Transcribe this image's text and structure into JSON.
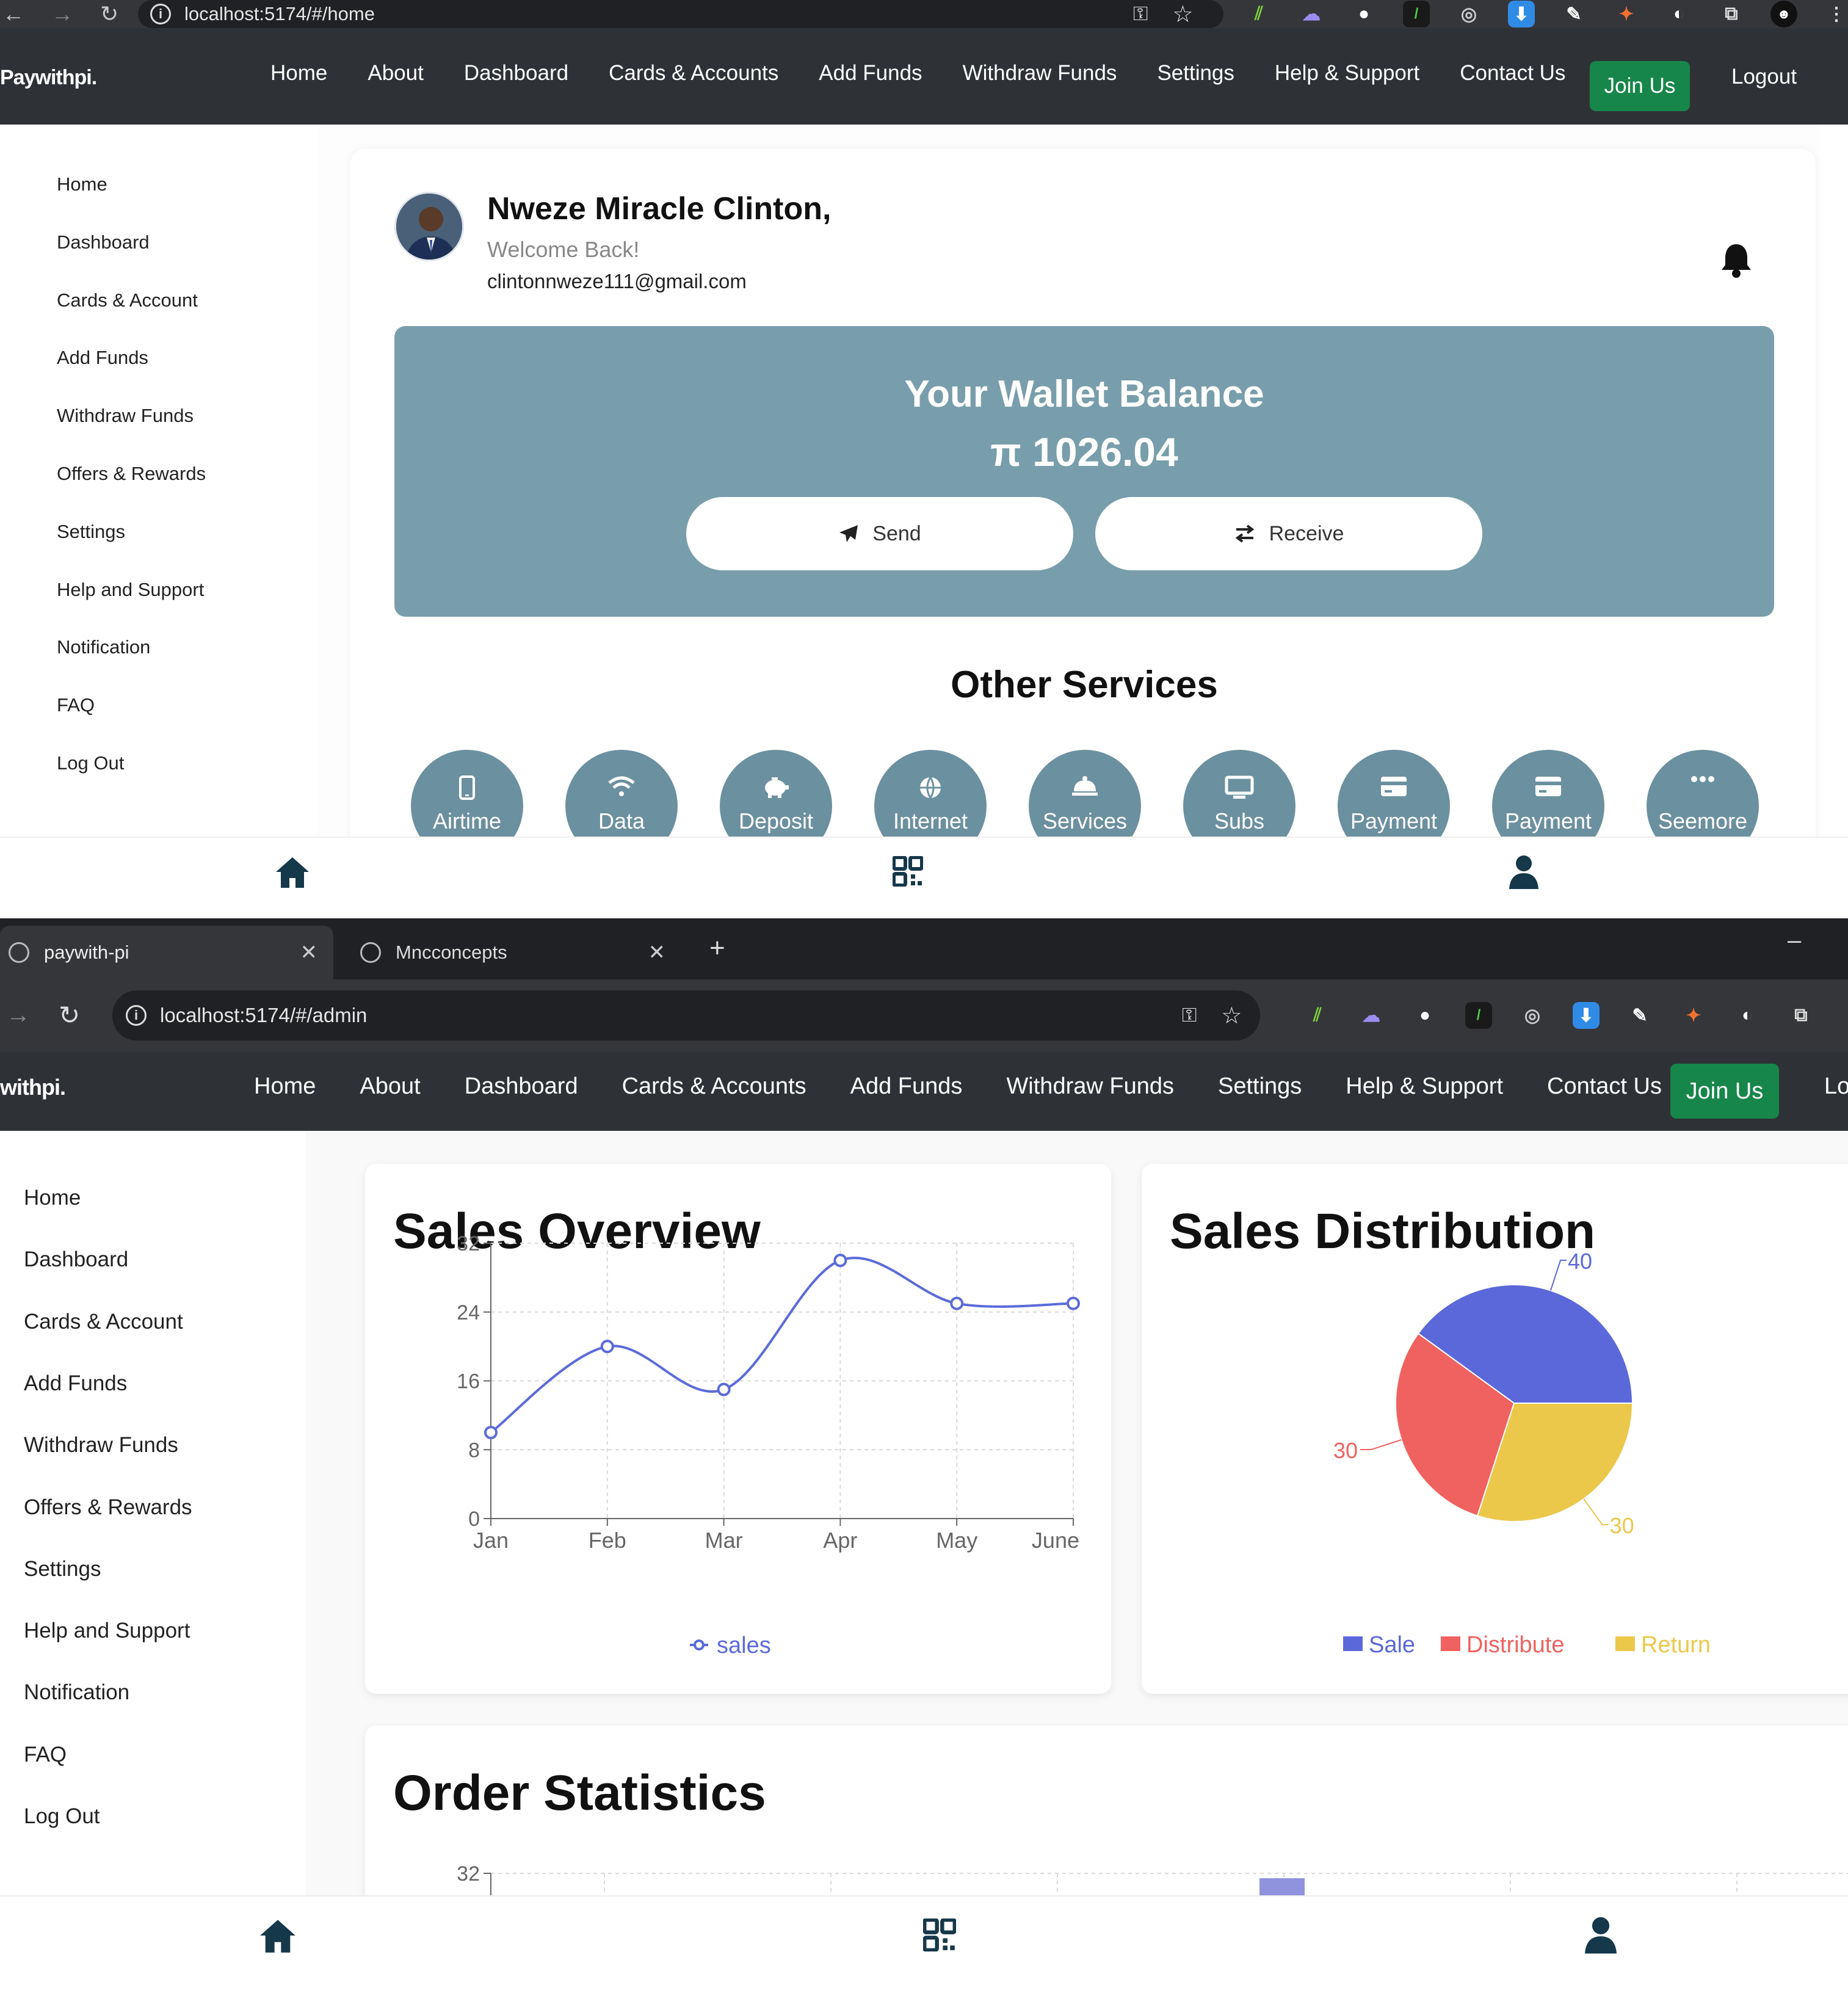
{
  "s1": {
    "url": "localhost:5174/#/home",
    "brand": "Paywithpi.",
    "nav": [
      "Home",
      "About",
      "Dashboard",
      "Cards & Accounts",
      "Add Funds",
      "Withdraw Funds",
      "Settings",
      "Help & Support",
      "Contact Us"
    ],
    "join": "Join Us",
    "logout": "Logout",
    "sidebar": [
      "Home",
      "Dashboard",
      "Cards & Account",
      "Add Funds",
      "Withdraw Funds",
      "Offers & Rewards",
      "Settings",
      "Help and Support",
      "Notification",
      "FAQ",
      "Log Out"
    ],
    "user": {
      "name": "Nweze Miracle Clinton,",
      "welcome": "Welcome Back!",
      "email": "clintonnweze111@gmail.com"
    },
    "wallet": {
      "title": "Your Wallet Balance",
      "amount": "π 1026.04",
      "send": "Send",
      "receive": "Receive"
    },
    "services_title": "Other Services",
    "services": [
      {
        "label": "Airtime",
        "icon": "phone-icon"
      },
      {
        "label": "Data",
        "icon": "wifi-icon"
      },
      {
        "label": "Deposit",
        "icon": "piggy-bank-icon"
      },
      {
        "label": "Internet",
        "icon": "globe-icon"
      },
      {
        "label": "Services",
        "icon": "bell-service-icon"
      },
      {
        "label": "Subs",
        "icon": "monitor-icon"
      },
      {
        "label": "Payment",
        "icon": "credit-card-icon"
      },
      {
        "label": "Payment",
        "icon": "credit-card-icon"
      },
      {
        "label": "Seemore",
        "icon": "more-icon"
      }
    ]
  },
  "s2": {
    "tabs": [
      "paywith-pi",
      "Mncconcepts"
    ],
    "url": "localhost:5174/#/admin",
    "brand": "withpi.",
    "nav": [
      "Home",
      "About",
      "Dashboard",
      "Cards & Accounts",
      "Add Funds",
      "Withdraw Funds",
      "Settings",
      "Help & Support",
      "Contact Us"
    ],
    "join": "Join Us",
    "logout_partial": "Lo",
    "sidebar": [
      "Home",
      "Dashboard",
      "Cards & Account",
      "Add Funds",
      "Withdraw Funds",
      "Offers & Rewards",
      "Settings",
      "Help and Support",
      "Notification",
      "FAQ",
      "Log Out"
    ],
    "panels": {
      "sales_overview": "Sales Overview",
      "sales_distribution": "Sales Distribution",
      "order_statistics": "Order Statistics"
    }
  },
  "chart_data": [
    {
      "type": "line",
      "title": "Sales Overview",
      "categories": [
        "Jan",
        "Feb",
        "Mar",
        "Apr",
        "May",
        "June"
      ],
      "series": [
        {
          "name": "sales",
          "values": [
            10,
            20,
            15,
            30,
            25,
            25
          ],
          "color": "#5b6bd8"
        }
      ],
      "yticks": [
        0,
        8,
        16,
        24,
        32
      ],
      "ylim": [
        0,
        32
      ],
      "grid": true,
      "legend": "bottom"
    },
    {
      "type": "pie",
      "title": "Sales Distribution",
      "labels": [
        "Sale",
        "Distribute",
        "Return"
      ],
      "values": [
        40,
        30,
        30
      ],
      "colors": [
        "#5b68d9",
        "#f0625f",
        "#ebc84a"
      ],
      "legend": "bottom"
    },
    {
      "type": "bar",
      "title": "Order Statistics",
      "yticks": [
        32
      ],
      "grid": true,
      "color": "#8f93dd"
    }
  ],
  "colors": {
    "nav_bg": "#2e3236",
    "join_green": "#17864a",
    "wallet_bg": "#799eab",
    "service_bg": "#6b909f",
    "bottom_icon": "#15384a"
  }
}
